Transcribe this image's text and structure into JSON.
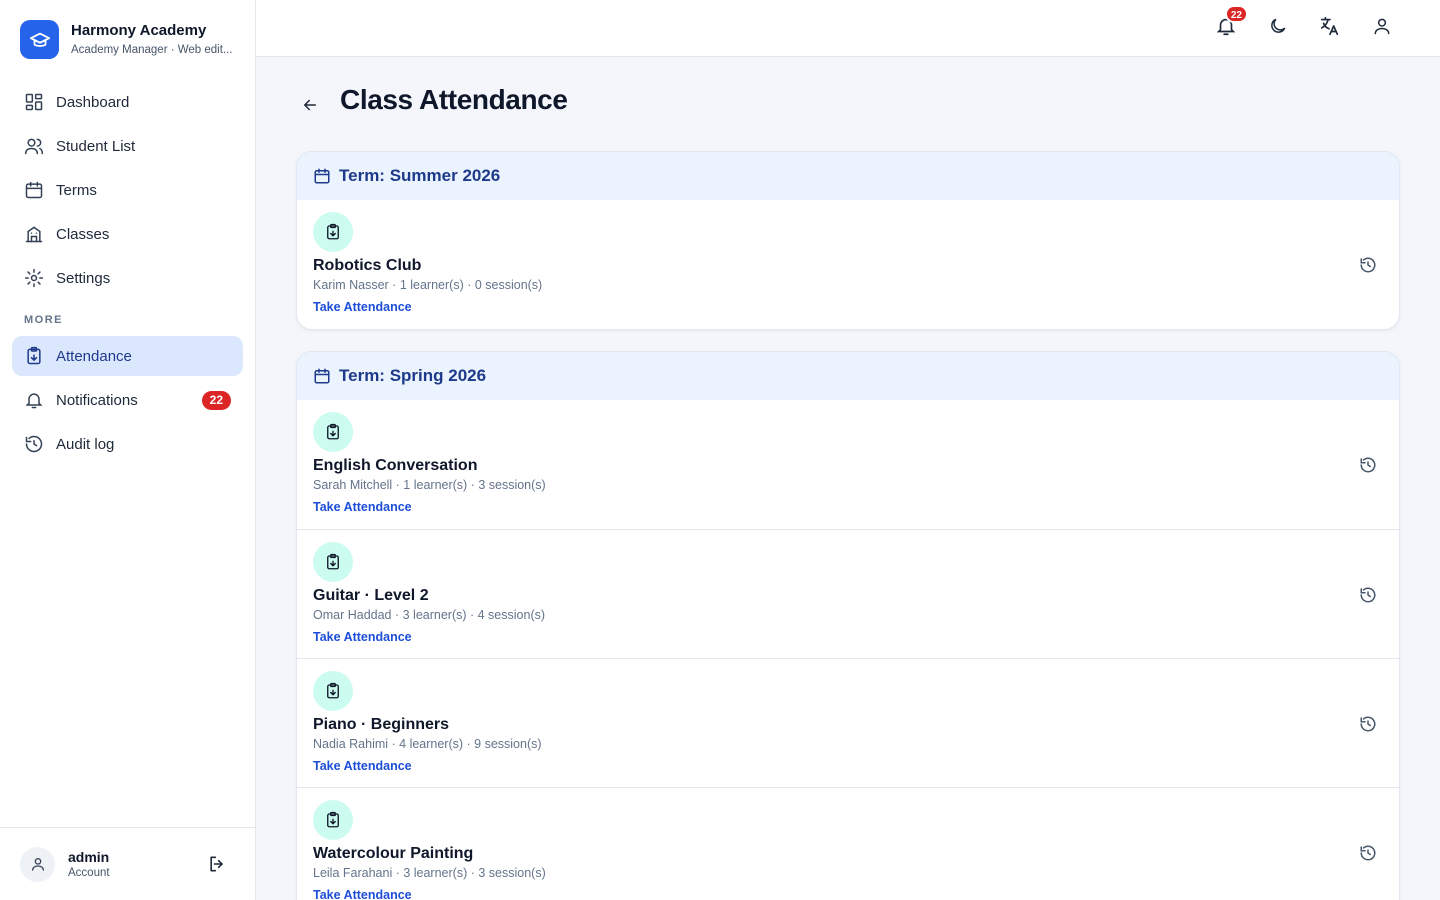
{
  "brand": {
    "title": "Harmony Academy",
    "subtitle": "Academy Manager · Web edit..."
  },
  "sidebar": {
    "items": [
      {
        "label": "Dashboard",
        "icon": "dashboard-icon"
      },
      {
        "label": "Student List",
        "icon": "users-icon"
      },
      {
        "label": "Terms",
        "icon": "calendar-icon"
      },
      {
        "label": "Classes",
        "icon": "building-icon"
      },
      {
        "label": "Settings",
        "icon": "gear-icon"
      }
    ],
    "more_label": "MORE",
    "more_items": [
      {
        "label": "Attendance",
        "icon": "clipboard-icon",
        "active": true
      },
      {
        "label": "Notifications",
        "icon": "bell-icon",
        "badge": "22"
      },
      {
        "label": "Audit log",
        "icon": "history-icon"
      }
    ]
  },
  "account": {
    "name": "admin",
    "role": "Account"
  },
  "topbar": {
    "notification_count": "22",
    "icons": [
      "bell-icon",
      "moon-icon",
      "translate-icon",
      "user-icon"
    ]
  },
  "page": {
    "title": "Class Attendance"
  },
  "terms": [
    {
      "title": "Term: Summer 2026",
      "classes": [
        {
          "name": "Robotics Club",
          "meta": "Karim Nasser · 1 learner(s) · 0 session(s)",
          "action": "Take Attendance"
        }
      ]
    },
    {
      "title": "Term: Spring 2026",
      "classes": [
        {
          "name": "English Conversation",
          "meta": "Sarah Mitchell · 1 learner(s) · 3 session(s)",
          "action": "Take Attendance"
        },
        {
          "name": "Guitar · Level 2",
          "meta": "Omar Haddad · 3 learner(s) · 4 session(s)",
          "action": "Take Attendance"
        },
        {
          "name": "Piano · Beginners",
          "meta": "Nadia Rahimi · 4 learner(s) · 9 session(s)",
          "action": "Take Attendance"
        },
        {
          "name": "Watercolour Painting",
          "meta": "Leila Farahani · 3 learner(s) · 3 session(s)",
          "action": "Take Attendance"
        }
      ]
    }
  ],
  "colors": {
    "accent": "#2563eb",
    "active_bg": "#dbe7fd",
    "term_header_bg": "#eaf3fe",
    "class_icon_bg": "#ccfbef",
    "badge": "#dc2626"
  }
}
